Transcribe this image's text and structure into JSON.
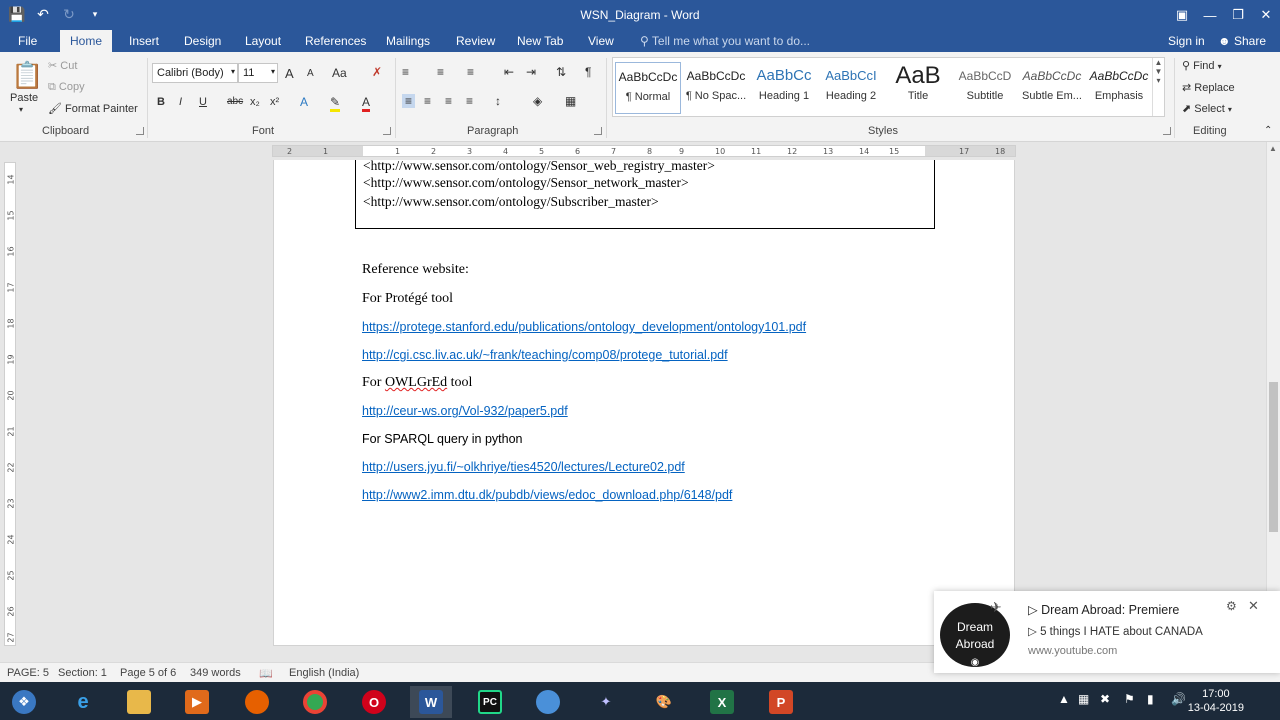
{
  "window": {
    "title": "WSN_Diagram - Word",
    "qat": {
      "save_icon": "save-icon",
      "undo_icon": "undo-icon",
      "redo_icon": "redo-icon"
    }
  },
  "tabs": [
    "File",
    "Home",
    "Insert",
    "Design",
    "Layout",
    "References",
    "Mailings",
    "Review",
    "New Tab",
    "View"
  ],
  "tell_me": "Tell me what you want to do...",
  "sign_in": "Sign in",
  "share": "Share",
  "ribbon": {
    "clipboard": {
      "paste": "Paste",
      "cut": "Cut",
      "copy": "Copy",
      "format_painter": "Format Painter",
      "label": "Clipboard"
    },
    "font": {
      "name": "Calibri (Body)",
      "size": "11",
      "label": "Font",
      "bold": "B",
      "italic": "I",
      "underline": "U",
      "strike": "abc",
      "subscript": "x₂",
      "superscript": "x²",
      "grow": "A",
      "shrink": "A",
      "case": "Aa"
    },
    "paragraph": {
      "label": "Paragraph"
    },
    "styles": {
      "label": "Styles",
      "items": [
        {
          "sample": "AaBbCcDc",
          "name": "¶ Normal"
        },
        {
          "sample": "AaBbCcDc",
          "name": "¶ No Spac..."
        },
        {
          "sample": "AaBbCc",
          "name": "Heading 1"
        },
        {
          "sample": "AaBbCcI",
          "name": "Heading 2"
        },
        {
          "sample": "AaB",
          "name": "Title"
        },
        {
          "sample": "AaBbCcD",
          "name": "Subtitle"
        },
        {
          "sample": "AaBbCcDc",
          "name": "Subtle Em..."
        },
        {
          "sample": "AaBbCcDc",
          "name": "Emphasis"
        }
      ]
    },
    "editing": {
      "find": "Find",
      "replace": "Replace",
      "select": "Select",
      "label": "Editing"
    }
  },
  "ruler": {
    "ticks": [
      "2",
      "1",
      "1",
      "2",
      "3",
      "4",
      "5",
      "6",
      "7",
      "8",
      "9",
      "10",
      "11",
      "12",
      "13",
      "14",
      "15",
      "17",
      "18"
    ]
  },
  "vruler": {
    "ticks": [
      "14",
      "15",
      "16",
      "17",
      "18",
      "19",
      "20",
      "21",
      "22",
      "23",
      "24",
      "25",
      "26",
      "27"
    ]
  },
  "document": {
    "code_lines": [
      "<http://www.sensor.com/ontology/Sensor_web_registry_master>",
      "<http://www.sensor.com/ontology/Sensor_network_master>",
      "<http://www.sensor.com/ontology/Subscriber_master>"
    ],
    "reference_heading": "Reference website:",
    "protege_heading": "For Protégé tool",
    "protege_links": [
      "https://protege.stanford.edu/publications/ontology_development/ontology101.pdf",
      "http://cgi.csc.liv.ac.uk/~frank/teaching/comp08/protege_tutorial.pdf"
    ],
    "owlgred_prefix": "For ",
    "owlgred_word": "OWLGrEd",
    "owlgred_suffix": " tool",
    "owlgred_link": "http://ceur-ws.org/Vol-932/paper5.pdf",
    "sparql_heading": "For SPARQL query in python",
    "sparql_links": [
      "http://users.jyu.fi/~olkhriye/ties4520/lectures/Lecture02.pdf",
      "http://www2.imm.dtu.dk/pubdb/views/edoc_download.php/6148/pdf"
    ]
  },
  "status": {
    "page": "PAGE: 5",
    "section": "Section: 1",
    "page_of": "Page 5 of 6",
    "words": "349 words",
    "language": "English (India)"
  },
  "notification": {
    "logo_line1": "Dream",
    "logo_line2": "Abroad",
    "title": "Dream Abroad: Premiere",
    "subtitle": "5 things I HATE about CANADA",
    "url": "www.youtube.com"
  },
  "taskbar": {
    "time": "17:00",
    "date": "13-04-2019"
  },
  "colors": {
    "word_blue": "#2b579a",
    "link": "#0563c1"
  }
}
